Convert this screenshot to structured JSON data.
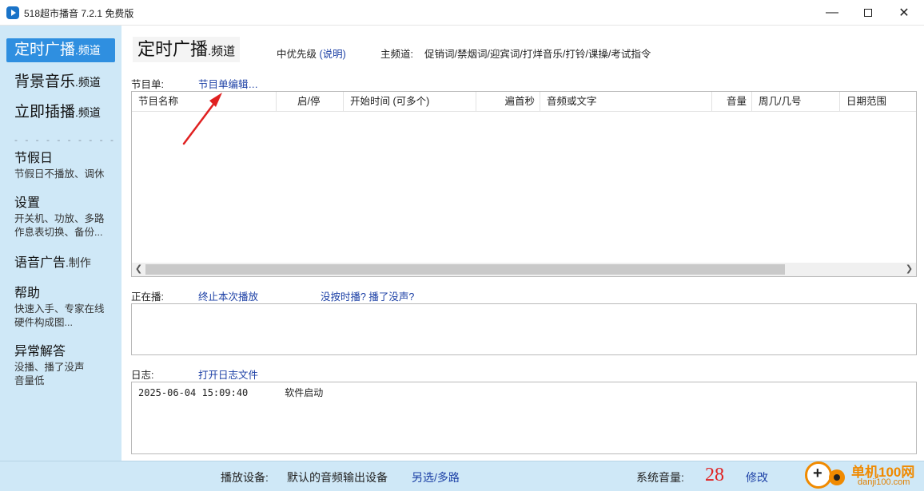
{
  "window": {
    "title": "518超市播音 7.2.1 免费版",
    "controls": {
      "minimize": "—",
      "close": "✕"
    }
  },
  "sidebar": {
    "channels": [
      {
        "main": "定时广播",
        "suffix": ".频道",
        "active": true
      },
      {
        "main": "背景音乐",
        "suffix": ".频道",
        "active": false
      },
      {
        "main": "立即插播",
        "suffix": ".频道",
        "active": false
      }
    ],
    "separator": "- - - - - - - - - -",
    "sections": [
      {
        "title": "节假日",
        "sub": [
          "节假日不播放、调休"
        ]
      },
      {
        "title": "设置",
        "sub": [
          "开关机、功放、多路",
          "作息表切换、备份..."
        ]
      },
      {
        "title": "语音广告",
        "title_suffix": ".制作",
        "sub": []
      },
      {
        "title": "帮助",
        "sub": [
          "快速入手、专家在线",
          "硬件构成图..."
        ]
      },
      {
        "title": "异常解答",
        "sub": [
          "没播、播了没声",
          "音量低"
        ]
      }
    ]
  },
  "main": {
    "title": "定时广播",
    "title_suffix": ".频道",
    "priority_label": "中优先级",
    "priority_link": "(说明)",
    "channel_label": "主频道:",
    "channel_value": "促销词/禁烟词/迎宾词/打烊音乐/打铃/课操/考试指令",
    "playlist_label": "节目单:",
    "playlist_edit_link": "节目单编辑…",
    "table_headers": [
      "节目名称",
      "启/停",
      "开始时间 (可多个)",
      "遍首秒",
      "音频或文字",
      "音量",
      "周几/几号",
      "日期范围"
    ],
    "now_playing_label": "正在播:",
    "stop_link": "终止本次播放",
    "trouble_link": "没按时播? 播了没声?",
    "log_label": "日志:",
    "open_log_link": "打开日志文件",
    "log_entries": [
      {
        "time": "2025-06-04 15:09:40",
        "message": "软件启动"
      }
    ]
  },
  "status_bar": {
    "device_label": "播放设备:",
    "device_value": "默认的音频输出设备",
    "device_link": "另选/多路",
    "volume_label": "系统音量:",
    "volume_value": "28",
    "volume_link": "修改"
  },
  "watermark": {
    "title": "单机100网",
    "url": "danji100.com"
  },
  "colors": {
    "sidebar_bg": "#cfe8f7",
    "active_nav": "#2f8fe0",
    "link": "#1b3fa5",
    "volume": "#e02020",
    "annotation_arrow": "#e02020"
  }
}
